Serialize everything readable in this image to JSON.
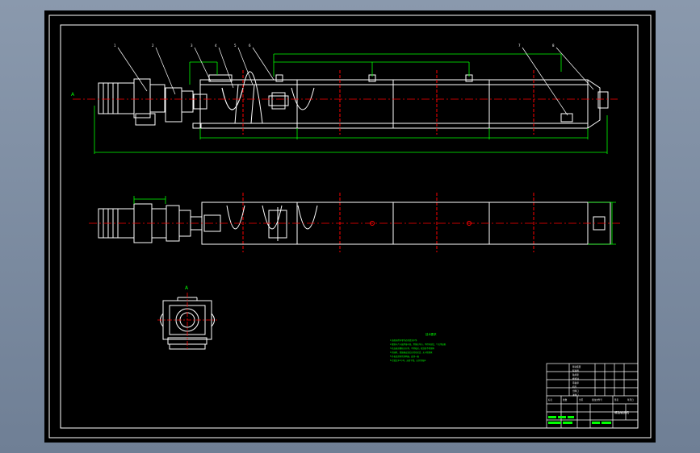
{
  "drawing": {
    "background": "#000000",
    "border_color": "#ffffff",
    "dim_color": "#00ff00",
    "center_color": "#ff0000",
    "line_color": "#ffffff",
    "section_label_left": "A",
    "section_label_view": "A",
    "notes_title": "技术要求",
    "notes": [
      "1.装配前所有零件必须清洗干净",
      "2.螺旋叶片与轴焊接牢固，焊缝应均匀，不得有裂纹、气孔等缺陷",
      "3.各连接处螺栓应拧紧，不得松动，密封处不得漏料",
      "4.减速机、联轴器安装后应转动灵活，无卡阻现象",
      "5.外表面涂防锈漆两遍，面漆一遍",
      "6.空载试车2小时，运转平稳，无异常噪声"
    ]
  },
  "title_block": {
    "part_rows": [
      "驱动装置",
      "联轴器",
      "轴承座",
      "螺旋轴",
      "吊轴承",
      "机壳",
      "出料口",
      "进料口"
    ],
    "labels": [
      "标记",
      "处数",
      "分区",
      "更改文件号",
      "签名",
      "年月日"
    ],
    "drawing_name": "螺旋输送机"
  }
}
